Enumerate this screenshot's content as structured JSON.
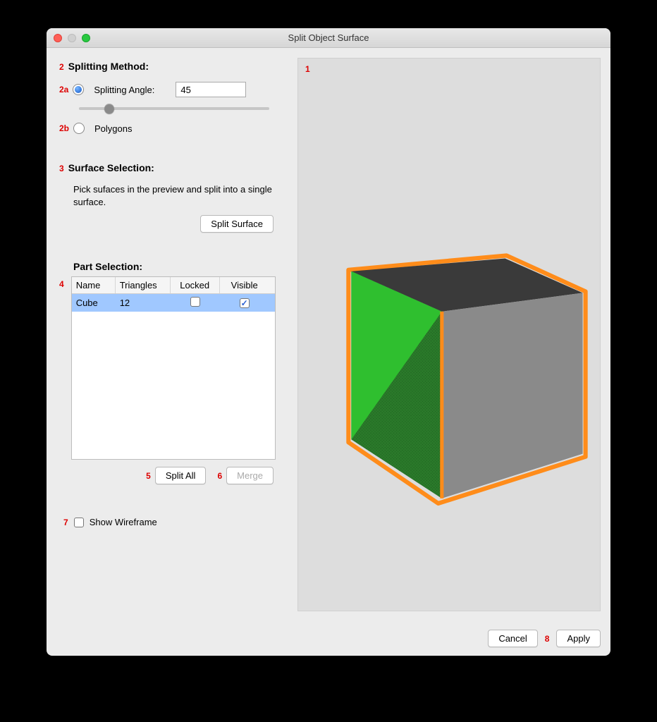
{
  "window": {
    "title": "Split Object Surface"
  },
  "annotations": {
    "a1": "1",
    "a2": "2",
    "a2a": "2a",
    "a2b": "2b",
    "a3": "3",
    "a4": "4",
    "a5": "5",
    "a6": "6",
    "a7": "7",
    "a8": "8"
  },
  "splitting": {
    "heading": "Splitting Method:",
    "angle_label": "Splitting Angle:",
    "angle_value": "45",
    "slider_pct": 16,
    "polygons_label": "Polygons"
  },
  "selection": {
    "heading": "Surface Selection:",
    "help": "Pick sufaces in the preview and split into a single surface.",
    "split_surface_btn": "Split Surface"
  },
  "parts": {
    "heading": "Part Selection:",
    "columns": {
      "name": "Name",
      "triangles": "Triangles",
      "locked": "Locked",
      "visible": "Visible"
    },
    "rows": [
      {
        "name": "Cube",
        "triangles": "12",
        "locked": false,
        "visible": true,
        "selected": true
      }
    ],
    "split_all_btn": "Split All",
    "merge_btn": "Merge"
  },
  "wireframe": {
    "label": "Show Wireframe",
    "checked": false
  },
  "footer": {
    "cancel": "Cancel",
    "apply": "Apply"
  },
  "colors": {
    "annotation": "#d00",
    "cube_outline": "#ff8c1a",
    "cube_green_light": "#2fbf2f",
    "cube_green_dark": "#2a7a2a",
    "cube_gray_top": "#3a3a3a",
    "cube_gray_side": "#8a8a8a"
  }
}
